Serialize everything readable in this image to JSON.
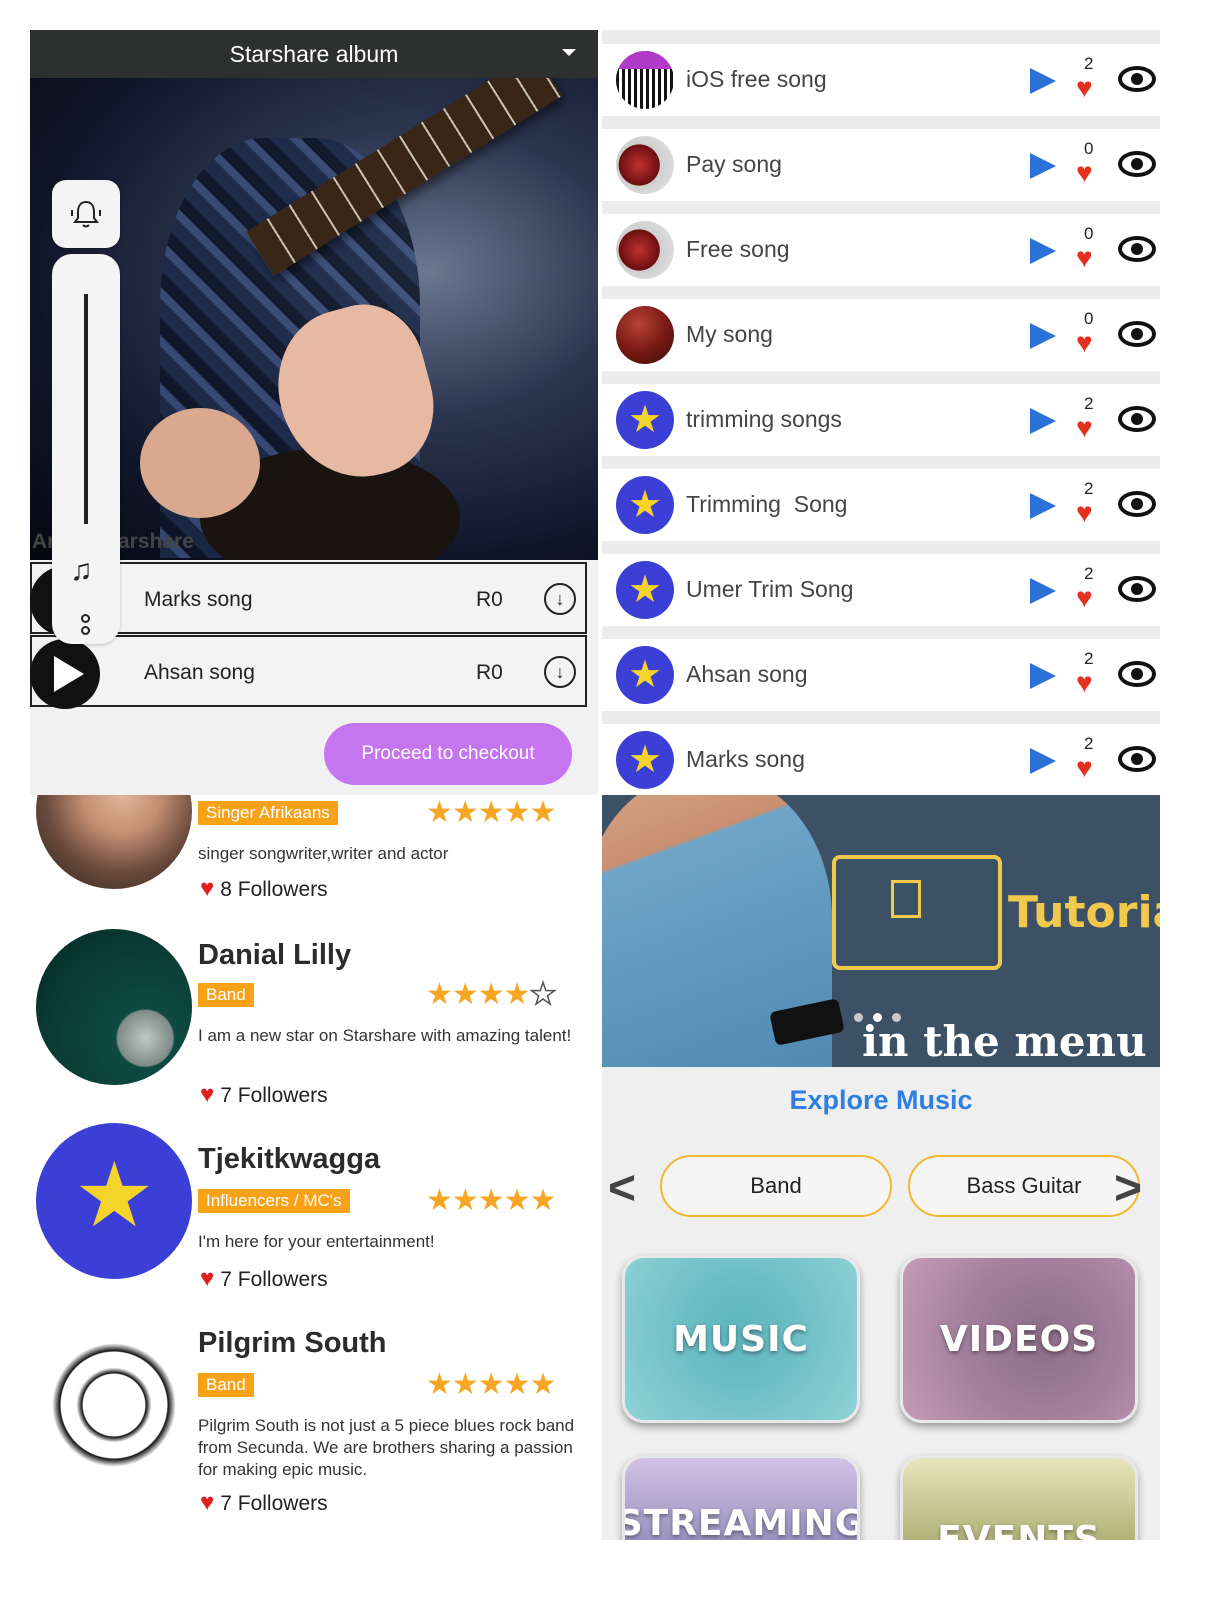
{
  "album": {
    "title": "Starshare album",
    "artist_left": "Ar",
    "artist_right": "arshare",
    "songs": [
      {
        "name": "Marks song",
        "price": "R0"
      },
      {
        "name": "Ahsan song",
        "price": "R0"
      }
    ],
    "checkout_label": "Proceed to checkout"
  },
  "song_list": [
    {
      "title": "iOS free song",
      "likes": "2",
      "thumb": "barcode"
    },
    {
      "title": "Pay song",
      "likes": "0",
      "thumb": "gloves"
    },
    {
      "title": "Free song",
      "likes": "0",
      "thumb": "gloves"
    },
    {
      "title": "My song",
      "likes": "0",
      "thumb": "maroon"
    },
    {
      "title": "trimming songs",
      "likes": "2",
      "thumb": "star"
    },
    {
      "title": "Trimming  Song",
      "likes": "2",
      "thumb": "star"
    },
    {
      "title": "Umer Trim Song",
      "likes": "2",
      "thumb": "star"
    },
    {
      "title": "Ahsan song",
      "likes": "2",
      "thumb": "star"
    },
    {
      "title": "Marks song",
      "likes": "2",
      "thumb": "star"
    }
  ],
  "artists": [
    {
      "name": "",
      "tag": "Singer Afrikaans",
      "rating": 5,
      "bio": "singer songwriter,writer and actor",
      "followers": "8 Followers"
    },
    {
      "name": "Danial Lilly",
      "tag": "Band",
      "rating": 4,
      "bio": "I am a new star on Starshare with amazing talent!",
      "followers": "7 Followers"
    },
    {
      "name": "Tjekitkwagga",
      "tag": "Influencers / MC's",
      "rating": 5,
      "bio": "I'm here for your entertainment!",
      "followers": "7 Followers"
    },
    {
      "name": "Pilgrim South",
      "tag": "Band",
      "rating": 5,
      "bio": "Pilgrim South is not just a 5 piece blues rock band from Secunda. We are brothers sharing a passion for making epic music.",
      "followers": "7 Followers"
    }
  ],
  "explore": {
    "banner_word": "Tutoria",
    "banner_line": "in the menu",
    "heading": "Explore Music",
    "prev": "<",
    "next": ">",
    "chips": [
      "Band",
      "Bass Guitar"
    ],
    "tiles": [
      "MUSIC",
      "VIDEOS",
      "STREAMING",
      "EVENTS"
    ]
  },
  "colors": {
    "accent_blue": "#2b71d8",
    "heart_red": "#e53020",
    "tag_orange": "#f8a21a",
    "checkout_purple": "#c575ef",
    "chip_border": "#f0b830"
  }
}
